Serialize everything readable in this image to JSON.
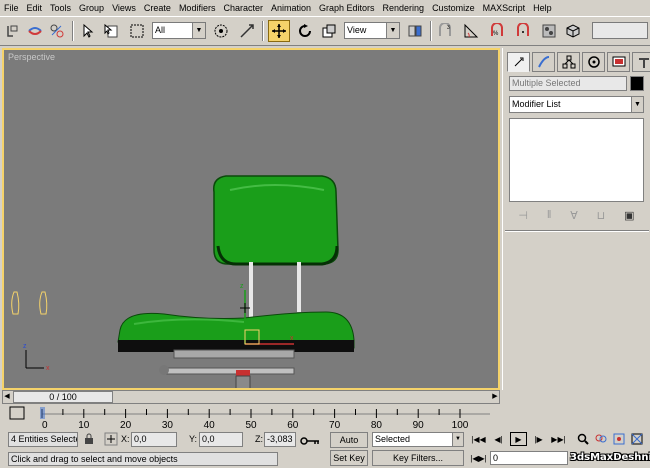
{
  "menu": [
    "File",
    "Edit",
    "Tools",
    "Group",
    "Views",
    "Create",
    "Modifiers",
    "Character",
    "Animation",
    "Graph Editors",
    "Rendering",
    "Customize",
    "MAXScript",
    "Help"
  ],
  "toolbar": {
    "selection_filter": "All",
    "reference_coord": "View",
    "icons": [
      "undo-icon",
      "redo-icon",
      "select-link-icon",
      "unlink-icon",
      "bind-spacewarp-icon",
      "select-object-icon",
      "select-by-name-icon",
      "rect-selection-icon",
      "window-crossing-icon",
      "select-move-icon",
      "select-rotate-icon",
      "select-scale-icon",
      "use-pivot-icon",
      "select-manipulate-icon",
      "snaps-icon",
      "angle-snap-icon",
      "percent-snap-icon",
      "spinner-snap-icon",
      "named-selection-icon",
      "mirror-icon",
      "align-icon",
      "curve-editor-icon",
      "schematic-view-icon",
      "material-editor-icon",
      "render-scene-icon",
      "quick-render-icon"
    ]
  },
  "viewport": {
    "label": "Perspective",
    "accent": "#f5d36a",
    "background": "#7b7b7b",
    "object_color": "#1a9e1a"
  },
  "command_panel": {
    "tabs": [
      "create-tab",
      "modify-tab",
      "hierarchy-tab",
      "motion-tab",
      "display-tab",
      "utilities-tab"
    ],
    "name_field": "Multiple Selected",
    "modifier_list": "Modifier List"
  },
  "time_slider": {
    "label": "0 / 100",
    "current": 0,
    "max": 100
  },
  "track_bar": {
    "ticks": [
      "0",
      "10",
      "20",
      "30",
      "40",
      "50",
      "60",
      "70",
      "80",
      "90",
      "100"
    ]
  },
  "status": {
    "selection_count": "4 Entities Selecte",
    "x_label": "X:",
    "x_value": "0,0",
    "y_label": "Y:",
    "y_value": "0,0",
    "z_label": "Z:",
    "z_value": "-3,083",
    "prompt": "Click and drag to select and move objects"
  },
  "animation": {
    "auto_key": "Auto Key",
    "set_key": "Set Key",
    "key_mode": "Selected",
    "key_filters": "Key Filters...",
    "frame": "0"
  },
  "watermark": "3dsMaxDeshnik"
}
